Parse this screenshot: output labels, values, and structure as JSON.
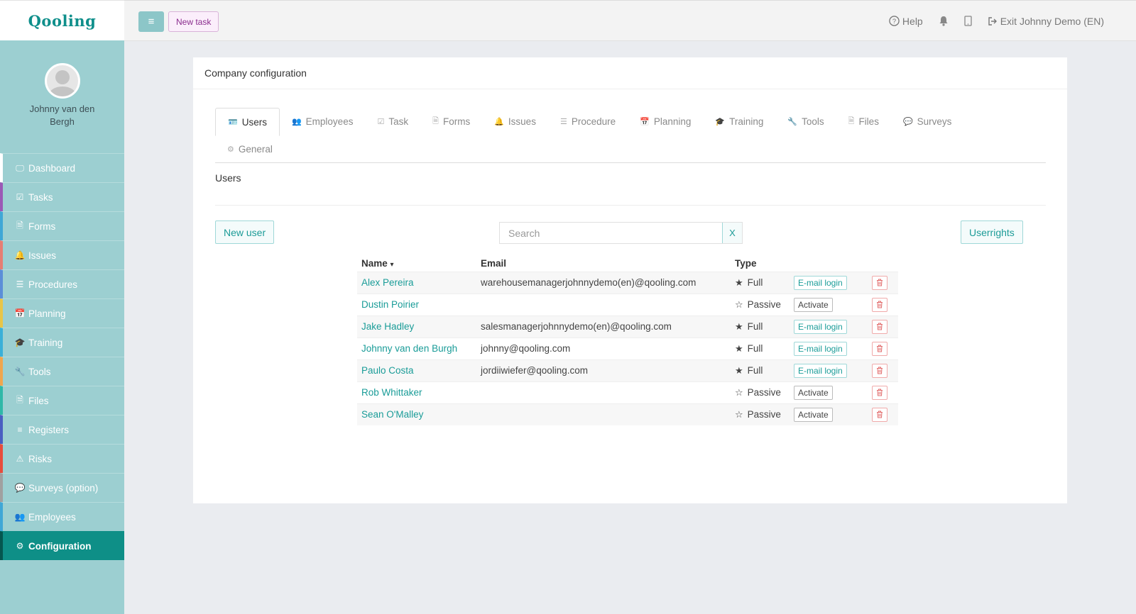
{
  "brand": {
    "logo": "Qooling"
  },
  "profile": {
    "name": "Johnny van den Bergh"
  },
  "nav": [
    {
      "label": "Dashboard",
      "icon": "🖵",
      "color": "#ffffff"
    },
    {
      "label": "Tasks",
      "icon": "☑",
      "color": "#9b59b6"
    },
    {
      "label": "Forms",
      "icon": "🗎",
      "color": "#3fa7d6"
    },
    {
      "label": "Issues",
      "icon": "🔔",
      "color": "#e67e73"
    },
    {
      "label": "Procedures",
      "icon": "☰",
      "color": "#5b8ed8"
    },
    {
      "label": "Planning",
      "icon": "📅",
      "color": "#e8c547"
    },
    {
      "label": "Training",
      "icon": "🎓",
      "color": "#3ab0d8"
    },
    {
      "label": "Tools",
      "icon": "🔧",
      "color": "#f0a64e"
    },
    {
      "label": "Files",
      "icon": "🗎",
      "color": "#2fb8a8"
    },
    {
      "label": "Registers",
      "icon": "≡",
      "color": "#4a5fc1"
    },
    {
      "label": "Risks",
      "icon": "⚠",
      "color": "#e74c3c"
    },
    {
      "label": "Surveys (option)",
      "icon": "💬",
      "color": "#a0a0a0"
    },
    {
      "label": "Employees",
      "icon": "👥",
      "color": "#3fa7d6"
    },
    {
      "label": "Configuration",
      "icon": "⚙",
      "color": "#05564f"
    }
  ],
  "topbar": {
    "menu_icon": "≡",
    "new_task": "New task",
    "help": "Help",
    "exit": "Exit Johnny Demo (EN)"
  },
  "card": {
    "title": "Company configuration"
  },
  "tabs_row1": [
    {
      "label": "Users",
      "icon": "🪪",
      "active": true
    },
    {
      "label": "Employees",
      "icon": "👥"
    },
    {
      "label": "Task",
      "icon": "☑"
    },
    {
      "label": "Forms",
      "icon": "🗎"
    },
    {
      "label": "Issues",
      "icon": "🔔"
    },
    {
      "label": "Procedure",
      "icon": "☰"
    },
    {
      "label": "Planning",
      "icon": "📅"
    },
    {
      "label": "Training",
      "icon": "🎓"
    },
    {
      "label": "Tools",
      "icon": "🔧"
    },
    {
      "label": "Files",
      "icon": "🗎"
    },
    {
      "label": "Surveys",
      "icon": "💬"
    }
  ],
  "tabs_row2": [
    {
      "label": "General",
      "icon": "⚙"
    }
  ],
  "section": {
    "title": "Users"
  },
  "actions": {
    "new_user": "New user",
    "userrights": "Userrights"
  },
  "search": {
    "placeholder": "Search",
    "clear": "X"
  },
  "table": {
    "headers": {
      "name": "Name",
      "email": "Email",
      "type": "Type"
    },
    "sort_icon": "▾",
    "rows": [
      {
        "name": "Alex Pereira",
        "email": "warehousemanagerjohnnydemo(en)@qooling.com",
        "type": "Full",
        "action": "E-mail login"
      },
      {
        "name": "Dustin Poirier",
        "email": "",
        "type": "Passive",
        "action": "Activate"
      },
      {
        "name": "Jake Hadley",
        "email": "salesmanagerjohnnydemo(en)@qooling.com",
        "type": "Full",
        "action": "E-mail login"
      },
      {
        "name": "Johnny van den Burgh",
        "email": "johnny@qooling.com",
        "type": "Full",
        "action": "E-mail login"
      },
      {
        "name": "Paulo Costa",
        "email": "jordiiwiefer@qooling.com",
        "type": "Full",
        "action": "E-mail login"
      },
      {
        "name": "Rob Whittaker",
        "email": "",
        "type": "Passive",
        "action": "Activate"
      },
      {
        "name": "Sean O'Malley",
        "email": "",
        "type": "Passive",
        "action": "Activate"
      }
    ]
  },
  "colors": {
    "accent": "#0e8f87",
    "sidebar": "#9ccfd1",
    "link": "#1a9c98",
    "danger": "#e26b6b"
  }
}
